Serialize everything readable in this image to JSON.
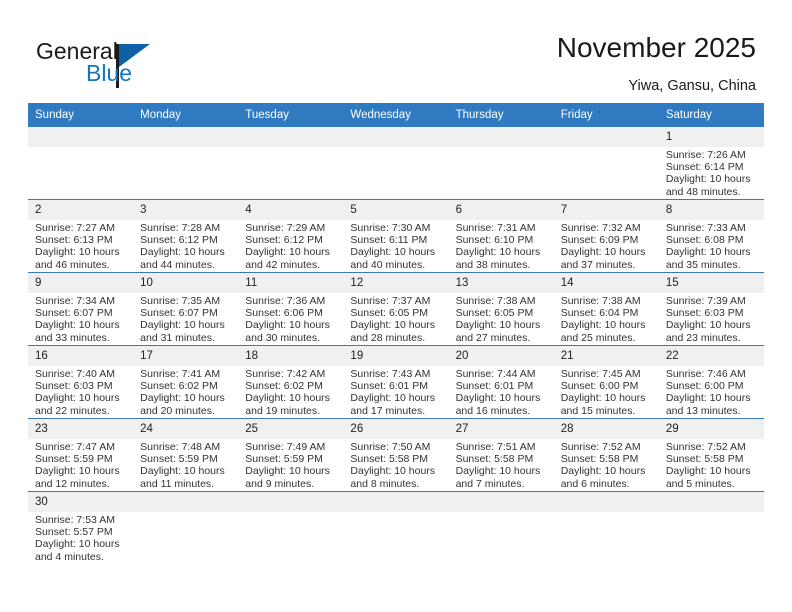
{
  "brand": {
    "name_part1": "General",
    "name_part2": "Blue",
    "primary_color": "#1175c0",
    "header_color": "#2f7ac1"
  },
  "header": {
    "title": "November 2025",
    "subtitle": "Yiwa, Gansu, China"
  },
  "calendar": {
    "weekday_headers": [
      "Sunday",
      "Monday",
      "Tuesday",
      "Wednesday",
      "Thursday",
      "Friday",
      "Saturday"
    ],
    "weeks": [
      [
        {
          "day": "",
          "sunrise": "",
          "sunset": "",
          "daylight": "",
          "daylight2": ""
        },
        {
          "day": "",
          "sunrise": "",
          "sunset": "",
          "daylight": "",
          "daylight2": ""
        },
        {
          "day": "",
          "sunrise": "",
          "sunset": "",
          "daylight": "",
          "daylight2": ""
        },
        {
          "day": "",
          "sunrise": "",
          "sunset": "",
          "daylight": "",
          "daylight2": ""
        },
        {
          "day": "",
          "sunrise": "",
          "sunset": "",
          "daylight": "",
          "daylight2": ""
        },
        {
          "day": "",
          "sunrise": "",
          "sunset": "",
          "daylight": "",
          "daylight2": ""
        },
        {
          "day": "1",
          "sunrise": "Sunrise: 7:26 AM",
          "sunset": "Sunset: 6:14 PM",
          "daylight": "Daylight: 10 hours",
          "daylight2": "and 48 minutes."
        }
      ],
      [
        {
          "day": "2",
          "sunrise": "Sunrise: 7:27 AM",
          "sunset": "Sunset: 6:13 PM",
          "daylight": "Daylight: 10 hours",
          "daylight2": "and 46 minutes."
        },
        {
          "day": "3",
          "sunrise": "Sunrise: 7:28 AM",
          "sunset": "Sunset: 6:12 PM",
          "daylight": "Daylight: 10 hours",
          "daylight2": "and 44 minutes."
        },
        {
          "day": "4",
          "sunrise": "Sunrise: 7:29 AM",
          "sunset": "Sunset: 6:12 PM",
          "daylight": "Daylight: 10 hours",
          "daylight2": "and 42 minutes."
        },
        {
          "day": "5",
          "sunrise": "Sunrise: 7:30 AM",
          "sunset": "Sunset: 6:11 PM",
          "daylight": "Daylight: 10 hours",
          "daylight2": "and 40 minutes."
        },
        {
          "day": "6",
          "sunrise": "Sunrise: 7:31 AM",
          "sunset": "Sunset: 6:10 PM",
          "daylight": "Daylight: 10 hours",
          "daylight2": "and 38 minutes."
        },
        {
          "day": "7",
          "sunrise": "Sunrise: 7:32 AM",
          "sunset": "Sunset: 6:09 PM",
          "daylight": "Daylight: 10 hours",
          "daylight2": "and 37 minutes."
        },
        {
          "day": "8",
          "sunrise": "Sunrise: 7:33 AM",
          "sunset": "Sunset: 6:08 PM",
          "daylight": "Daylight: 10 hours",
          "daylight2": "and 35 minutes."
        }
      ],
      [
        {
          "day": "9",
          "sunrise": "Sunrise: 7:34 AM",
          "sunset": "Sunset: 6:07 PM",
          "daylight": "Daylight: 10 hours",
          "daylight2": "and 33 minutes."
        },
        {
          "day": "10",
          "sunrise": "Sunrise: 7:35 AM",
          "sunset": "Sunset: 6:07 PM",
          "daylight": "Daylight: 10 hours",
          "daylight2": "and 31 minutes."
        },
        {
          "day": "11",
          "sunrise": "Sunrise: 7:36 AM",
          "sunset": "Sunset: 6:06 PM",
          "daylight": "Daylight: 10 hours",
          "daylight2": "and 30 minutes."
        },
        {
          "day": "12",
          "sunrise": "Sunrise: 7:37 AM",
          "sunset": "Sunset: 6:05 PM",
          "daylight": "Daylight: 10 hours",
          "daylight2": "and 28 minutes."
        },
        {
          "day": "13",
          "sunrise": "Sunrise: 7:38 AM",
          "sunset": "Sunset: 6:05 PM",
          "daylight": "Daylight: 10 hours",
          "daylight2": "and 27 minutes."
        },
        {
          "day": "14",
          "sunrise": "Sunrise: 7:38 AM",
          "sunset": "Sunset: 6:04 PM",
          "daylight": "Daylight: 10 hours",
          "daylight2": "and 25 minutes."
        },
        {
          "day": "15",
          "sunrise": "Sunrise: 7:39 AM",
          "sunset": "Sunset: 6:03 PM",
          "daylight": "Daylight: 10 hours",
          "daylight2": "and 23 minutes."
        }
      ],
      [
        {
          "day": "16",
          "sunrise": "Sunrise: 7:40 AM",
          "sunset": "Sunset: 6:03 PM",
          "daylight": "Daylight: 10 hours",
          "daylight2": "and 22 minutes."
        },
        {
          "day": "17",
          "sunrise": "Sunrise: 7:41 AM",
          "sunset": "Sunset: 6:02 PM",
          "daylight": "Daylight: 10 hours",
          "daylight2": "and 20 minutes."
        },
        {
          "day": "18",
          "sunrise": "Sunrise: 7:42 AM",
          "sunset": "Sunset: 6:02 PM",
          "daylight": "Daylight: 10 hours",
          "daylight2": "and 19 minutes."
        },
        {
          "day": "19",
          "sunrise": "Sunrise: 7:43 AM",
          "sunset": "Sunset: 6:01 PM",
          "daylight": "Daylight: 10 hours",
          "daylight2": "and 17 minutes."
        },
        {
          "day": "20",
          "sunrise": "Sunrise: 7:44 AM",
          "sunset": "Sunset: 6:01 PM",
          "daylight": "Daylight: 10 hours",
          "daylight2": "and 16 minutes."
        },
        {
          "day": "21",
          "sunrise": "Sunrise: 7:45 AM",
          "sunset": "Sunset: 6:00 PM",
          "daylight": "Daylight: 10 hours",
          "daylight2": "and 15 minutes."
        },
        {
          "day": "22",
          "sunrise": "Sunrise: 7:46 AM",
          "sunset": "Sunset: 6:00 PM",
          "daylight": "Daylight: 10 hours",
          "daylight2": "and 13 minutes."
        }
      ],
      [
        {
          "day": "23",
          "sunrise": "Sunrise: 7:47 AM",
          "sunset": "Sunset: 5:59 PM",
          "daylight": "Daylight: 10 hours",
          "daylight2": "and 12 minutes."
        },
        {
          "day": "24",
          "sunrise": "Sunrise: 7:48 AM",
          "sunset": "Sunset: 5:59 PM",
          "daylight": "Daylight: 10 hours",
          "daylight2": "and 11 minutes."
        },
        {
          "day": "25",
          "sunrise": "Sunrise: 7:49 AM",
          "sunset": "Sunset: 5:59 PM",
          "daylight": "Daylight: 10 hours",
          "daylight2": "and 9 minutes."
        },
        {
          "day": "26",
          "sunrise": "Sunrise: 7:50 AM",
          "sunset": "Sunset: 5:58 PM",
          "daylight": "Daylight: 10 hours",
          "daylight2": "and 8 minutes."
        },
        {
          "day": "27",
          "sunrise": "Sunrise: 7:51 AM",
          "sunset": "Sunset: 5:58 PM",
          "daylight": "Daylight: 10 hours",
          "daylight2": "and 7 minutes."
        },
        {
          "day": "28",
          "sunrise": "Sunrise: 7:52 AM",
          "sunset": "Sunset: 5:58 PM",
          "daylight": "Daylight: 10 hours",
          "daylight2": "and 6 minutes."
        },
        {
          "day": "29",
          "sunrise": "Sunrise: 7:52 AM",
          "sunset": "Sunset: 5:58 PM",
          "daylight": "Daylight: 10 hours",
          "daylight2": "and 5 minutes."
        }
      ],
      [
        {
          "day": "30",
          "sunrise": "Sunrise: 7:53 AM",
          "sunset": "Sunset: 5:57 PM",
          "daylight": "Daylight: 10 hours",
          "daylight2": "and 4 minutes."
        },
        {
          "day": "",
          "sunrise": "",
          "sunset": "",
          "daylight": "",
          "daylight2": ""
        },
        {
          "day": "",
          "sunrise": "",
          "sunset": "",
          "daylight": "",
          "daylight2": ""
        },
        {
          "day": "",
          "sunrise": "",
          "sunset": "",
          "daylight": "",
          "daylight2": ""
        },
        {
          "day": "",
          "sunrise": "",
          "sunset": "",
          "daylight": "",
          "daylight2": ""
        },
        {
          "day": "",
          "sunrise": "",
          "sunset": "",
          "daylight": "",
          "daylight2": ""
        },
        {
          "day": "",
          "sunrise": "",
          "sunset": "",
          "daylight": "",
          "daylight2": ""
        }
      ]
    ]
  }
}
